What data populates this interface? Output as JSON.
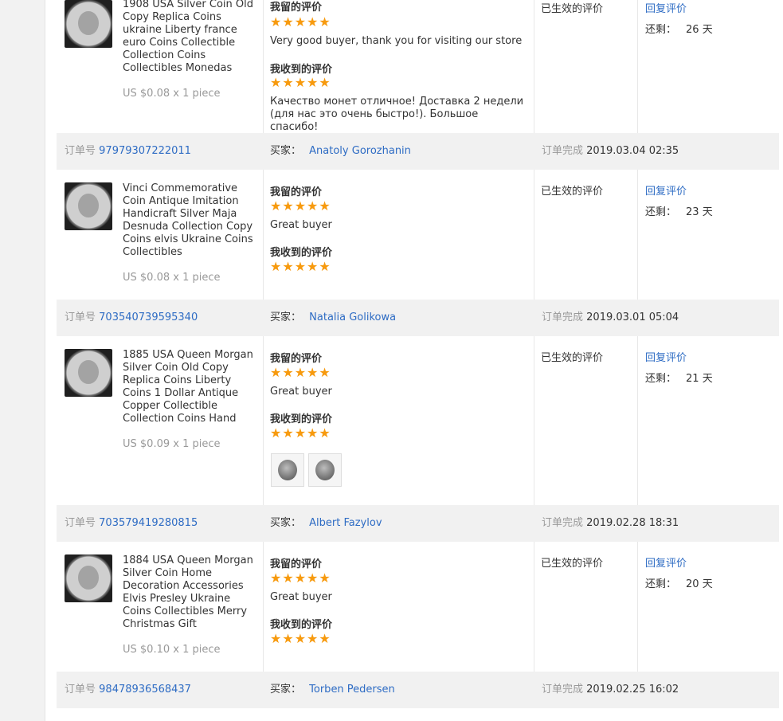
{
  "labels": {
    "my_feedback": "我留的评价",
    "received_feedback": "我收到的评价",
    "status_effective": "已生效的评价",
    "reply": "回复评价",
    "remaining": "还剩：",
    "order_no": "订单号",
    "buyer": "买家：",
    "order_done": "订单完成"
  },
  "stars_text": "★★★★★",
  "colors": {
    "link": "#2e6cc4",
    "star": "#f79a0e",
    "order_bg": "#f1f1f1"
  },
  "items": [
    {
      "title": "1908 USA Silver Coin Old Copy Replica Coins ukraine Liberty france euro Coins Collectible Collection Coins Collectibles Monedas",
      "price": "US $0.08 x 1 piece",
      "my_text": "Very good buyer, thank you for visiting our store",
      "received_text": "Качество монет отличное! Доставка 2 недели (для нас это очень быстро!). Большое спасибо!",
      "days": "26 天"
    },
    {
      "title": "Vinci Commemorative Coin Antique Imitation Handicraft Silver Maja Desnuda Collection Copy Coins elvis Ukraine Coins Collectibles",
      "price": "US $0.08 x 1 piece",
      "my_text": "Great buyer",
      "days": "23 天"
    },
    {
      "title": "1885 USA Queen Morgan Silver Coin Old Copy Replica Coins Liberty Coins 1 Dollar Antique Copper Collectible Collection Coins Hand",
      "price": "US $0.09 x 1 piece",
      "my_text": "Great buyer",
      "days": "21 天"
    },
    {
      "title": "1884 USA Queen Morgan Silver Coin Home Decoration Accessories Elvis Presley Ukraine Coins Collectibles Merry Christmas Gift",
      "price": "US $0.10 x 1 piece",
      "my_text": "Great buyer",
      "days": "20 天"
    }
  ],
  "orders": [
    {
      "number": "97979307222011",
      "buyer": "Anatoly Gorozhanin",
      "completed": "2019.03.04 02:35"
    },
    {
      "number": "703540739595340",
      "buyer": "Natalia Golikowa",
      "completed": "2019.03.01 05:04"
    },
    {
      "number": "703579419280815",
      "buyer": "Albert Fazylov",
      "completed": "2019.02.28 18:31"
    },
    {
      "number": "98478936568437",
      "buyer": "Torben Pedersen",
      "completed": "2019.02.25 16:02"
    }
  ]
}
